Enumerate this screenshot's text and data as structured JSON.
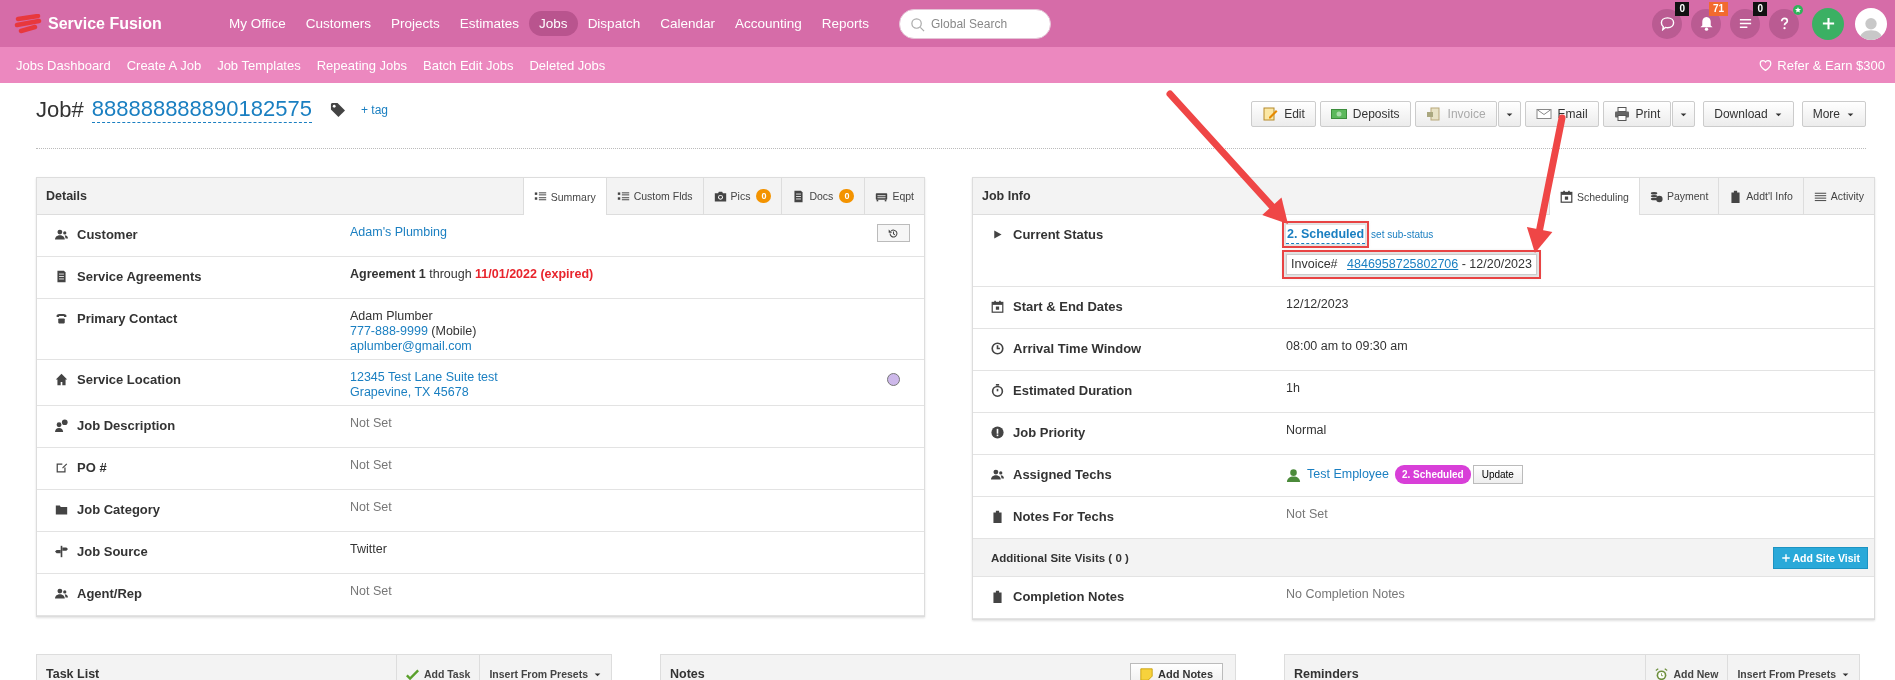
{
  "brand": {
    "name": "Service Fusion"
  },
  "nav": [
    {
      "label": "My Office",
      "selected": false
    },
    {
      "label": "Customers",
      "selected": false
    },
    {
      "label": "Projects",
      "selected": false
    },
    {
      "label": "Estimates",
      "selected": false
    },
    {
      "label": "Jobs",
      "selected": true
    },
    {
      "label": "Dispatch",
      "selected": false
    },
    {
      "label": "Calendar",
      "selected": false
    },
    {
      "label": "Accounting",
      "selected": false
    },
    {
      "label": "Reports",
      "selected": false
    }
  ],
  "search": {
    "placeholder": "Global Search"
  },
  "header_buttons": [
    {
      "kind": "chat",
      "badge": "0",
      "color": "#111111"
    },
    {
      "kind": "bell",
      "badge": "71",
      "color": "#f26a2e"
    },
    {
      "kind": "list",
      "badge": "0",
      "color": "#111111"
    },
    {
      "kind": "help",
      "starred": true
    },
    {
      "kind": "add"
    },
    {
      "kind": "avatar"
    }
  ],
  "subnav": [
    {
      "label": "Jobs Dashboard"
    },
    {
      "label": "Create A Job"
    },
    {
      "label": "Job Templates"
    },
    {
      "label": "Repeating Jobs"
    },
    {
      "label": "Batch Edit Jobs"
    },
    {
      "label": "Deleted Jobs"
    }
  ],
  "refer": {
    "label": "Refer & Earn $300"
  },
  "job": {
    "prefix": "Job#",
    "number": "888888888890182575",
    "add_tag": "+ tag"
  },
  "actions": [
    {
      "label": "Edit",
      "kind": "plain",
      "disabled": false
    },
    {
      "label": "Deposits",
      "kind": "plain",
      "disabled": false
    },
    {
      "label": "Invoice",
      "kind": "split",
      "disabled": true
    },
    {
      "label": "Email",
      "kind": "plain",
      "disabled": false
    },
    {
      "label": "Print",
      "kind": "split",
      "disabled": false
    },
    {
      "label": "Download",
      "kind": "dropdown",
      "disabled": false
    },
    {
      "label": "More",
      "kind": "dropdown",
      "disabled": false
    }
  ],
  "details": {
    "title": "Details",
    "tabs": [
      {
        "label": "Summary",
        "selected": true
      },
      {
        "label": "Custom Flds",
        "selected": false
      },
      {
        "label": "Pics",
        "count": "0",
        "selected": false
      },
      {
        "label": "Docs",
        "count": "0",
        "selected": false
      },
      {
        "label": "Eqpt",
        "selected": false
      }
    ],
    "rows": [
      {
        "kind": "field",
        "label": "Customer",
        "history_button": true,
        "lines": [
          {
            "kind": "items",
            "segments": [
              {
                "kind": "link",
                "text": "Adam's Plumbing"
              }
            ]
          }
        ]
      },
      {
        "kind": "field",
        "label": "Service Agreements",
        "lines": [
          {
            "kind": "text",
            "segments": [
              {
                "kind": "bold",
                "text": "Agreement 1"
              },
              {
                "kind": "text",
                "text": " through "
              },
              {
                "kind": "alert",
                "text": "11/01/2022 (expired)"
              }
            ]
          }
        ]
      },
      {
        "kind": "field",
        "label": "Primary Contact",
        "lines": [
          {
            "kind": "items",
            "segments": [
              {
                "kind": "text",
                "text": "Adam Plumber"
              }
            ]
          },
          {
            "kind": "text",
            "segments": [
              {
                "kind": "link",
                "text": "777-888-9999"
              },
              {
                "kind": "text",
                "text": " (Mobile)"
              }
            ]
          },
          {
            "kind": "items",
            "segments": [
              {
                "kind": "link",
                "text": "aplumber@gmail.com"
              }
            ]
          }
        ]
      },
      {
        "kind": "field",
        "label": "Service Location",
        "color": "#cdb8ea",
        "lines": [
          {
            "kind": "items",
            "segments": [
              {
                "kind": "link",
                "text": "12345 Test Lane Suite test"
              }
            ]
          },
          {
            "kind": "items",
            "segments": [
              {
                "kind": "link",
                "text": "Grapevine, TX 45678"
              }
            ]
          }
        ]
      },
      {
        "kind": "field",
        "label": "Job Description",
        "lines": [
          {
            "kind": "items",
            "segments": [
              {
                "kind": "muted",
                "text": "Not Set"
              }
            ]
          }
        ]
      },
      {
        "kind": "field",
        "label": "PO #",
        "lines": [
          {
            "kind": "items",
            "segments": [
              {
                "kind": "muted",
                "text": "Not Set"
              }
            ]
          }
        ]
      },
      {
        "kind": "field",
        "label": "Job Category",
        "lines": [
          {
            "kind": "items",
            "segments": [
              {
                "kind": "muted",
                "text": "Not Set"
              }
            ]
          }
        ]
      },
      {
        "kind": "field",
        "label": "Job Source",
        "lines": [
          {
            "kind": "items",
            "segments": [
              {
                "kind": "text",
                "text": "Twitter"
              }
            ]
          }
        ]
      },
      {
        "kind": "field",
        "label": "Agent/Rep",
        "lines": [
          {
            "kind": "items",
            "segments": [
              {
                "kind": "muted",
                "text": "Not Set"
              }
            ]
          }
        ]
      }
    ]
  },
  "job_info": {
    "title": "Job Info",
    "tabs": [
      {
        "label": "Scheduling",
        "selected": true
      },
      {
        "label": "Payment",
        "selected": false
      },
      {
        "label": "Addt'l Info",
        "selected": false
      },
      {
        "label": "Activity",
        "selected": false
      }
    ],
    "rows": [
      {
        "kind": "field",
        "label": "Current Status",
        "lines": [
          {
            "kind": "items",
            "segments": [
              {
                "kind": "status",
                "text": "2. Scheduled",
                "highlighted": true
              },
              {
                "kind": "small_link",
                "text": "set sub-status"
              }
            ]
          },
          {
            "kind": "boxed",
            "highlighted": true,
            "segments": [
              {
                "kind": "text",
                "text": "Invoice#  "
              },
              {
                "kind": "link",
                "text": "4846958725802706"
              },
              {
                "kind": "text",
                "text": " - 12/20/2023"
              }
            ]
          }
        ]
      },
      {
        "kind": "field",
        "label": "Start & End Dates",
        "lines": [
          {
            "kind": "items",
            "segments": [
              {
                "kind": "text",
                "text": "12/12/2023"
              }
            ]
          }
        ]
      },
      {
        "kind": "field",
        "label": "Arrival Time Window",
        "lines": [
          {
            "kind": "items",
            "segments": [
              {
                "kind": "text",
                "text": "08:00 am to 09:30 am"
              }
            ]
          }
        ]
      },
      {
        "kind": "field",
        "label": "Estimated Duration",
        "lines": [
          {
            "kind": "items",
            "segments": [
              {
                "kind": "text",
                "text": "1h"
              }
            ]
          }
        ]
      },
      {
        "kind": "field",
        "label": "Job Priority",
        "lines": [
          {
            "kind": "items",
            "segments": [
              {
                "kind": "text",
                "text": "Normal"
              }
            ]
          }
        ]
      },
      {
        "kind": "field",
        "label": "Assigned Techs",
        "lines": [
          {
            "kind": "items",
            "segments": [
              {
                "kind": "avatar"
              },
              {
                "kind": "link",
                "text": "Test Employee"
              },
              {
                "kind": "badge",
                "text": "2. Scheduled",
                "color": "#d83fd8"
              },
              {
                "kind": "button",
                "text": "Update"
              }
            ]
          }
        ]
      },
      {
        "kind": "field",
        "label": "Notes For Techs",
        "lines": [
          {
            "kind": "items",
            "segments": [
              {
                "kind": "muted",
                "text": "Not Set"
              }
            ]
          }
        ]
      },
      {
        "kind": "section",
        "label": "Additional Site Visits ( 0 )",
        "button": "Add Site Visit"
      },
      {
        "kind": "field",
        "label": "Completion Notes",
        "lines": [
          {
            "kind": "items",
            "segments": [
              {
                "kind": "muted",
                "text": "No Completion Notes"
              }
            ]
          }
        ]
      }
    ]
  },
  "bottom_panels": [
    {
      "title": "Task List",
      "tools": [
        {
          "kind": "tool",
          "label": "Add Task"
        },
        {
          "kind": "dropdown",
          "label": "Insert From Presets"
        }
      ]
    },
    {
      "title": "Notes",
      "tools": [
        {
          "kind": "button",
          "label": "Add Notes"
        }
      ]
    },
    {
      "title": "Reminders",
      "tools": [
        {
          "kind": "tool",
          "label": "Add New"
        },
        {
          "kind": "dropdown",
          "label": "Insert From Presets"
        }
      ]
    }
  ],
  "annotations": [
    {
      "kind": "arrow"
    },
    {
      "kind": "arrow"
    }
  ]
}
